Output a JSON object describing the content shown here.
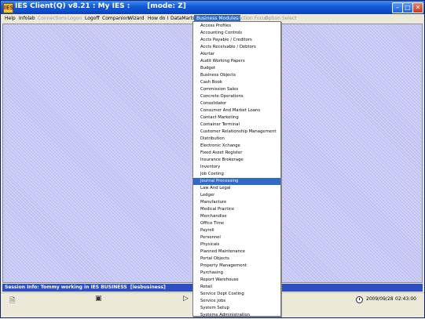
{
  "window": {
    "title": "IES Client(Q) v8.21 : My IES :       [mode: Z]",
    "app_icon": "IES"
  },
  "menubar": {
    "items": [
      {
        "label": "Help",
        "enabled": true
      },
      {
        "label": "Infolab",
        "enabled": true
      },
      {
        "label": "Connections",
        "enabled": false
      },
      {
        "label": "Logon",
        "enabled": false
      },
      {
        "label": "Logoff",
        "enabled": true
      },
      {
        "label": "Companion",
        "enabled": true
      },
      {
        "label": "Wizard",
        "enabled": true
      },
      {
        "label": "How do I",
        "enabled": true
      },
      {
        "label": "DataMarts",
        "enabled": true
      },
      {
        "label": "Business Modules",
        "enabled": true,
        "open": true
      },
      {
        "label": "Action Focus",
        "enabled": false
      },
      {
        "label": "Option Select",
        "enabled": false
      }
    ]
  },
  "dropdown": {
    "selected": "Journal Processing",
    "items": [
      "Access Profiles",
      "Accounting Controls",
      "Accts Payable / Creditors",
      "Accts Receivable / Debtors",
      "Alertar",
      "Audit Working Papers",
      "Budget",
      "Business Objects",
      "Cash Book",
      "Commission Sales",
      "Concrete Operations",
      "Consolidator",
      "Consumer And Market Loans",
      "Contact Marketing",
      "Container Terminal",
      "Customer Relationship Management",
      "Distribution",
      "Electronic Xchange",
      "Fixed Asset Register",
      "Insurance Brokerage",
      "Inventory",
      "Job Costing",
      "Journal Processing",
      "Law And Legal",
      "Ledger",
      "Manufacture",
      "Medical Practice",
      "Merchandise",
      "Office Time",
      "Payroll",
      "Personnel",
      "Physicals",
      "Planned Maintenance",
      "Portal Objects",
      "Property Management",
      "Purchasing",
      "Report Warehouse",
      "Retail",
      "Service Dept Costing",
      "Service Jobs",
      "System Setup",
      "Systems Administration"
    ]
  },
  "status": {
    "session_info": "Session Info: Tommy working in IES BUSINESS  [iesbusiness]"
  },
  "bottombar": {
    "date": "2009/09/28",
    "time": "02:43:00",
    "icons": [
      "document-icon",
      "save-icon",
      "run-icon",
      "clock-icon"
    ]
  },
  "colors": {
    "titlebar": "#0a4ac8",
    "desktop": "#c4c4f4",
    "statusbar": "#2d4fc2",
    "selection": "#316ac5"
  }
}
